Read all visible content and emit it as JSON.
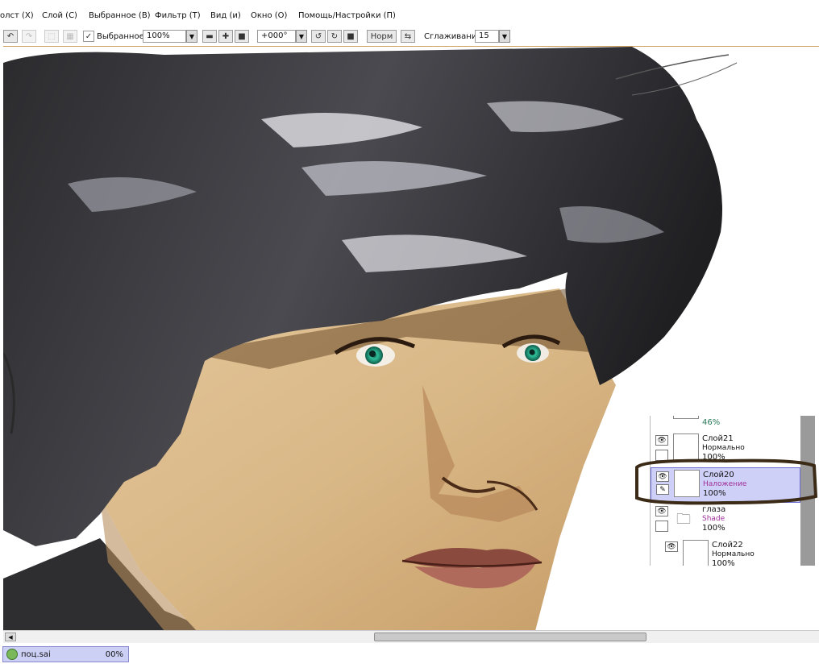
{
  "menu": {
    "items": [
      "олст (X)",
      "Слой (С)",
      "Выбранное (В)",
      "Фильтр (Т)",
      "Вид (и)",
      "Окно (О)",
      "Помощь/Настройки (П)"
    ]
  },
  "toolbar": {
    "selection_label": "Выбранное",
    "zoom_value": "100%",
    "rotation_value": "+000°",
    "mode_button": "Норм",
    "smoothing_label": "Сглаживание",
    "smoothing_value": "15"
  },
  "layers": {
    "top_partial": {
      "opacity": "46%"
    },
    "items": [
      {
        "name": "Слой21",
        "mode": "Нормально",
        "opacity": "100%"
      },
      {
        "name": "Слой20",
        "mode": "Наложение",
        "opacity": "100%",
        "selected": true
      },
      {
        "name": "глаза",
        "mode": "Shade",
        "opacity": "100%",
        "folder": true
      },
      {
        "name": "Слой22",
        "mode": "Нормально",
        "opacity": "100%"
      }
    ]
  },
  "status": {
    "file_name": "поц.sai",
    "progress": "00%"
  },
  "colors": {
    "selected_layer": "#cfd0f7",
    "mode_text": "#a0309a",
    "annotation": "#3b2a16"
  }
}
